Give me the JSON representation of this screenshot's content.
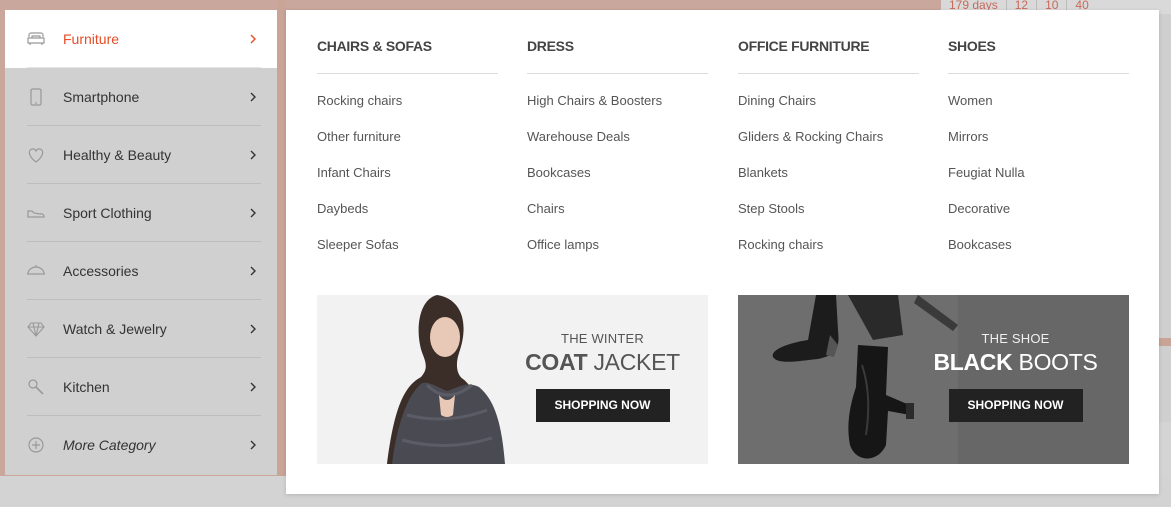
{
  "countdown": [
    "179 days",
    "12",
    "10",
    "40"
  ],
  "sidebar": {
    "items": [
      {
        "label": "Furniture",
        "icon": "sofa-icon",
        "active": true
      },
      {
        "label": "Smartphone",
        "icon": "smartphone-icon"
      },
      {
        "label": "Healthy & Beauty",
        "icon": "heart-icon"
      },
      {
        "label": "Sport Clothing",
        "icon": "shoe-icon"
      },
      {
        "label": "Accessories",
        "icon": "cap-icon"
      },
      {
        "label": "Watch & Jewelry",
        "icon": "diamond-icon"
      },
      {
        "label": "Kitchen",
        "icon": "spoon-icon"
      },
      {
        "label": "More Category",
        "icon": "plus-circle-icon"
      }
    ]
  },
  "mega": {
    "columns": [
      {
        "title": "CHAIRS & SOFAS",
        "links": [
          "Rocking chairs",
          "Other furniture",
          "Infant Chairs",
          "Daybeds",
          "Sleeper Sofas"
        ]
      },
      {
        "title": "DRESS",
        "links": [
          "High Chairs & Boosters",
          "Warehouse Deals",
          "Bookcases",
          "Chairs",
          "Office lamps"
        ]
      },
      {
        "title": "OFFICE FURNITURE",
        "links": [
          "Dining Chairs",
          "Gliders & Rocking Chairs",
          "Blankets",
          "Step Stools",
          "Rocking chairs"
        ]
      },
      {
        "title": "SHOES",
        "links": [
          "Women",
          "Mirrors",
          "Feugiat Nulla",
          "Decorative",
          "Bookcases"
        ]
      }
    ],
    "banners": [
      {
        "subtitle": "THE WINTER",
        "title_bold": "COAT",
        "title_rest": " JACKET",
        "button": "SHOPPING NOW"
      },
      {
        "subtitle": "THE SHOE",
        "title_bold": "BLACK",
        "title_rest": " BOOTS",
        "button": "SHOPPING NOW"
      }
    ]
  },
  "colors": {
    "accent": "#e54d26",
    "button": "#222222"
  }
}
